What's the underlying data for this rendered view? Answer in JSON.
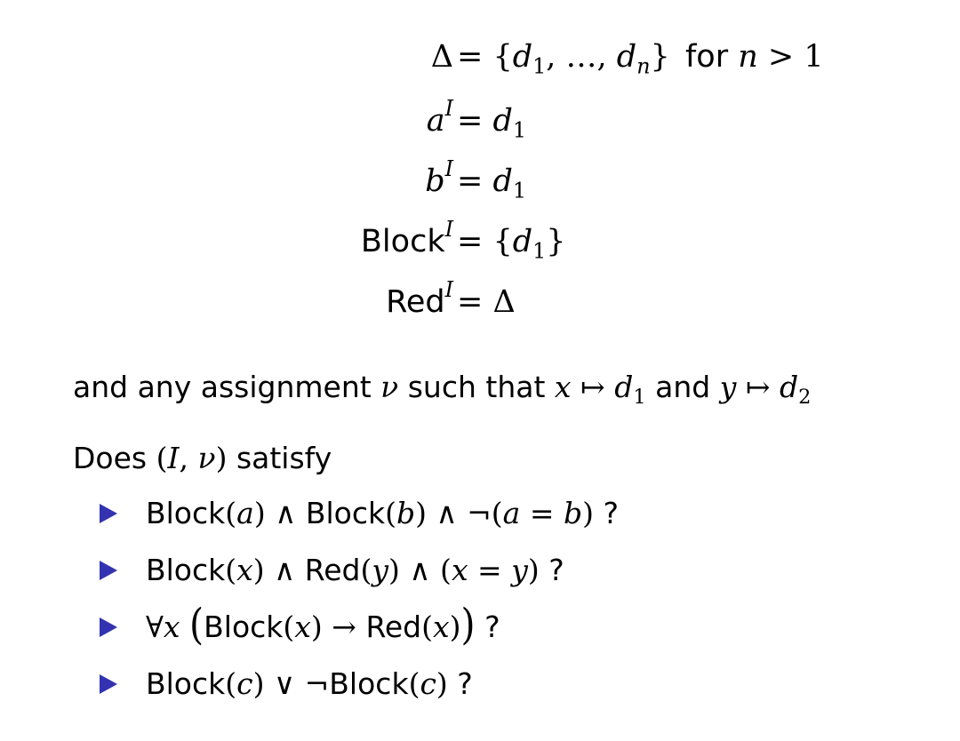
{
  "equations": [
    {
      "lhs_sym": "Δ",
      "rhs_text": "= {d₁, …, dₙ}",
      "suffix_text": "for",
      "suffix_var": "n",
      "suffix_rest": "> 1"
    },
    {
      "lhs_sym": "a",
      "lhs_sup": "𝓘",
      "rhs_text": "= d₁"
    },
    {
      "lhs_sym": "b",
      "lhs_sup": "𝓘",
      "rhs_text": "= d₁"
    },
    {
      "lhs_word": "Block",
      "lhs_sup": "𝓘",
      "rhs_text": "= {d₁}"
    },
    {
      "lhs_word": "Red",
      "lhs_sup": "𝓘",
      "rhs_text": "= Δ"
    }
  ],
  "assignment_line": {
    "t1": "and any assignment",
    "nu": "ν",
    "t2": "such that",
    "x": "x",
    "maps": "↦",
    "d1": "d",
    "d1_sub": "1",
    "t3": "and",
    "y": "y",
    "d2": "d",
    "d2_sub": "2"
  },
  "question": {
    "t1": "Does",
    "pair": "(𝓘, ν)",
    "t2": "satisfy"
  },
  "bullets": [
    "Block(a) ∧ Block(b) ∧ ¬(a = b) ?",
    "Block(x) ∧ Red(y) ∧ (x = y) ?",
    "∀x (Block(x) → Red(x)) ?",
    "Block(c) ∨ ¬Block(c) ?"
  ],
  "colors": {
    "bullet": "#3333b2",
    "text": "#000000"
  }
}
